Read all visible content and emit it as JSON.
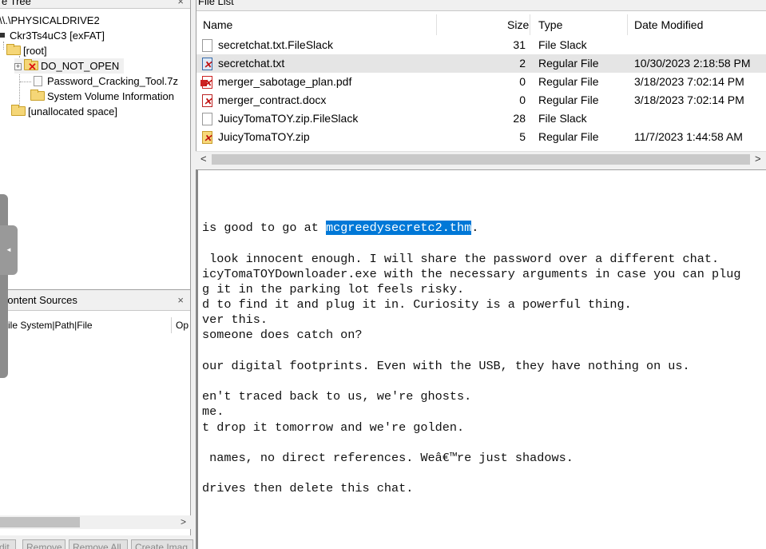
{
  "evidence_tree": {
    "title": "e Tree",
    "close": "×",
    "items": [
      {
        "label": "\\\\.\\PHYSICALDRIVE2"
      },
      {
        "label": "Ckr3Ts4uC3 [exFAT]"
      },
      {
        "label": "[root]"
      },
      {
        "label": "DO_NOT_OPEN"
      },
      {
        "label": "Password_Cracking_Tool.7z"
      },
      {
        "label": "System Volume Information"
      },
      {
        "label": "[unallocated space]"
      }
    ]
  },
  "content_sources": {
    "title": "Content Sources",
    "close": "×",
    "col1": "::File System|Path|File",
    "col2": "Op"
  },
  "buttons": [
    "dit",
    "Remove",
    "Remove All",
    "Create Imag"
  ],
  "file_list": {
    "title": "File List",
    "columns": {
      "name": "Name",
      "size": "Size",
      "type": "Type",
      "date": "Date Modified"
    },
    "rows": [
      {
        "name": "secretchat.txt.FileSlack",
        "size": "31",
        "type": "File Slack",
        "date": "",
        "icon": "file-icon"
      },
      {
        "name": "secretchat.txt",
        "size": "2",
        "type": "Regular File",
        "date": "10/30/2023 2:18:58 PM",
        "icon": "deleted-text-file-icon"
      },
      {
        "name": "merger_sabotage_plan.pdf",
        "size": "0",
        "type": "Regular File",
        "date": "3/18/2023 7:02:14 PM",
        "icon": "deleted-pdf-icon"
      },
      {
        "name": "merger_contract.docx",
        "size": "0",
        "type": "Regular File",
        "date": "3/18/2023 7:02:14 PM",
        "icon": "deleted-doc-icon"
      },
      {
        "name": "JuicyTomaTOY.zip.FileSlack",
        "size": "28",
        "type": "File Slack",
        "date": "",
        "icon": "file-icon"
      },
      {
        "name": "JuicyTomaTOY.zip",
        "size": "5",
        "type": "Regular File",
        "date": "11/7/2023 1:44:58 AM",
        "icon": "deleted-zip-icon"
      }
    ],
    "scroll_left": "<",
    "scroll_right": ">"
  },
  "viewer": {
    "lines": [
      {
        "pre": "is good to go at ",
        "hl": "mcgreedysecretc2.thm",
        "post": "."
      },
      {
        "pre": " look innocent enough. I will share the password over a different chat."
      },
      {
        "pre": "icyTomaTOYDownloader.exe with the necessary arguments in case you can plug"
      },
      {
        "pre": "g it in the parking lot feels risky."
      },
      {
        "pre": "d to find it and plug it in. Curiosity is a powerful thing."
      },
      {
        "pre": "ver this."
      },
      {
        "pre": "someone does catch on?"
      },
      {
        "pre": ""
      },
      {
        "pre": "our digital footprints. Even with the USB, they have nothing on us."
      },
      {
        "pre": ""
      },
      {
        "pre": "en't traced back to us, we're ghosts."
      },
      {
        "pre": "me."
      },
      {
        "pre": "t drop it tomorrow and we're golden."
      },
      {
        "pre": ""
      },
      {
        "pre": " names, no direct references. Weâ€™re just shadows."
      },
      {
        "pre": ""
      },
      {
        "pre": "drives then delete this chat."
      }
    ]
  }
}
